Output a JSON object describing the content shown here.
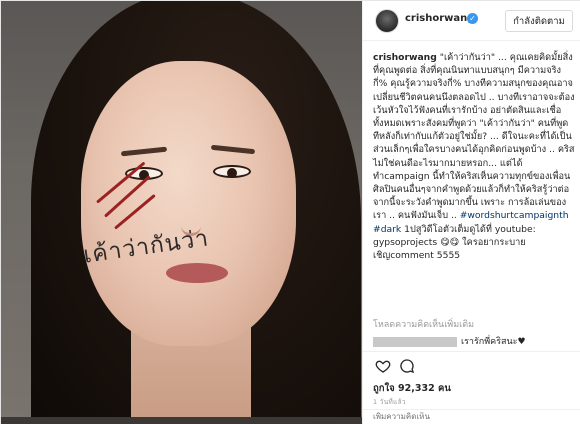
{
  "post": {
    "username": "crishorwang",
    "verified_mark": "✓",
    "follow_label": "กำลังติดตาม",
    "photo_cheek_text": "เค้าว่ากันว่า",
    "caption": {
      "user": "crishorwang",
      "text_1": " \"เค้าว่ากันว่า\" ... คุณเคยคิดมั้ยสิ่งที่คุณพูดต่อ สิ่งที่คุณนินทาแบบสนุกๆ มีความจริงกี่% คุณรู้ความจริงกี่% บางทีความสนุกของคุณอาจเปลี่ยนชีวิตคนคนนึงตลอดไป .. บางทีเราอาจจะต้องเว้นหัวใจไว้ฟังคนที่เรารักบ้าง อย่าตัดสินและเชื่อทั้งหมดเพราะสังคมที่พูดว่า \"เค้าว่ากันว่า\" คนที่พูดทีหลังก็เท่ากับแก้ตัวอยู่ใช่มั้ย? ... ดีใจนะคะที่ได้เป็นส่วนเล็กๆเพื่อใครบางคนได้อุกคิดก่อนพูดบ้าง .. คริสไม่ใช่คนดีอะไรมากมายหรอก... แต่ได้ทำcampaign นี้ทำให้คริสเห็นความทุกข์ของเพื่อนศิลปินคนอื่นๆจากคำพูดด้วยแล้วก็ทำให้คริสรู้ว่าต่อจากนี้จะระวังคำพูดมากขึ้น เพราะ การล้อเล่นของเรา .. คนฟังมันเจ็บ .. ",
      "hashtag_1": "#wordshurtcampaignth",
      "hashtag_2": "#dark",
      "text_2": " 1ปสูวิดีโอตัวเต็มดูได้ที่ youtube: gypsoprojects 😋😋 ใครอยากระบายเชิญcomment 5555"
    },
    "view_comments_label": "โหลดความคิดเห็นเพิ่มเติม",
    "comment": {
      "text": "เรารักพี่คริสนะ♥"
    },
    "likes_text": "ถูกใจ 92,332 คน",
    "time_text": "1 วันที่แล้ว",
    "add_comment_placeholder": "เพิ่มความคิดเห็น",
    "icons": {
      "heart": "heart-icon",
      "comment": "comment-icon",
      "verified": "verified-badge-icon"
    },
    "colors": {
      "verified_blue": "#3897f0",
      "link_blue": "#003569",
      "muted": "#999999"
    }
  }
}
